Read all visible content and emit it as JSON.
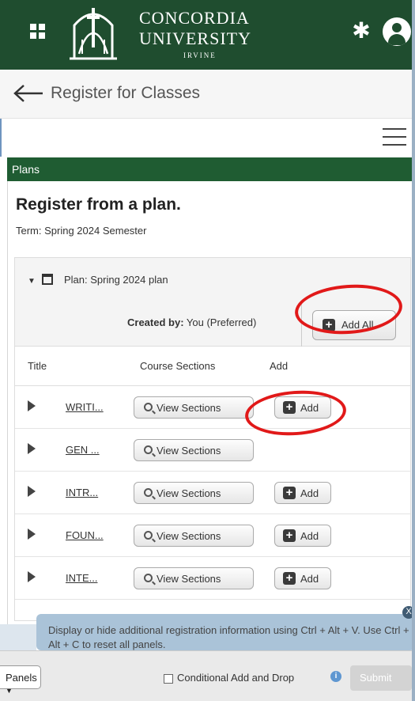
{
  "header": {
    "logo_line1": "CONCORDIA",
    "logo_line2": "UNIVERSITY",
    "logo_line3": "IRVINE",
    "brand_color": "#1f4d2f"
  },
  "page": {
    "title": "Register for Classes"
  },
  "section": {
    "label": "Plans",
    "heading": "Register from a plan.",
    "term": "Term: Spring 2024 Semester"
  },
  "plan": {
    "name": "Plan: Spring 2024 plan",
    "created_label": "Created by:",
    "created_value": " You (Preferred)",
    "add_all_label": "Add All"
  },
  "table": {
    "columns": [
      "Title",
      "Course Sections",
      "Add"
    ],
    "view_sections_label": "View Sections",
    "add_label": "Add",
    "rows": [
      {
        "title": "WRITI...",
        "has_add": true
      },
      {
        "title": "GEN ...",
        "has_add": false
      },
      {
        "title": "INTR...",
        "has_add": true
      },
      {
        "title": "FOUN...",
        "has_add": true
      },
      {
        "title": "INTE...",
        "has_add": true
      }
    ]
  },
  "tooltip": {
    "text": "Display or hide additional registration information using Ctrl + Alt + V. Use Ctrl + Alt + C to reset all panels.",
    "close": "X"
  },
  "footer": {
    "panels_label": "Panels",
    "conditional_label": "Conditional Add and Drop",
    "info": "i",
    "submit_label": "Submit"
  },
  "annotation_color": "#e11919"
}
